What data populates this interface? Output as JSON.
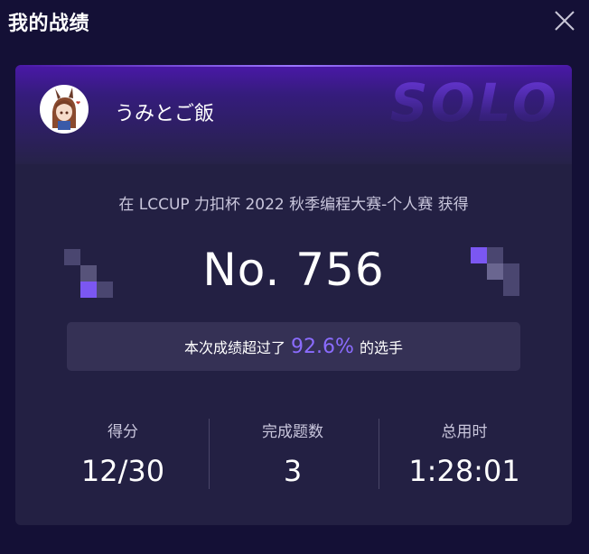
{
  "window": {
    "title": "我的战绩",
    "close_icon": "close-icon"
  },
  "card": {
    "mode_watermark": "SOLO",
    "user": {
      "name": "うみとご飯",
      "avatar_icon": "anime-avatar"
    },
    "event_line": "在 LCCUP 力扣杯 2022 秋季编程大赛-个人赛 获得",
    "rank": "No. 756",
    "banner": {
      "prefix": "本次成绩超过了",
      "percent": "92.6%",
      "suffix": "的选手"
    },
    "stats": [
      {
        "label": "得分",
        "value": "12/30"
      },
      {
        "label": "完成题数",
        "value": "3"
      },
      {
        "label": "总用时",
        "value": "1:28:01"
      }
    ]
  },
  "colors": {
    "accent": "#8b6cff",
    "background": "#141036",
    "card": "#232043"
  }
}
